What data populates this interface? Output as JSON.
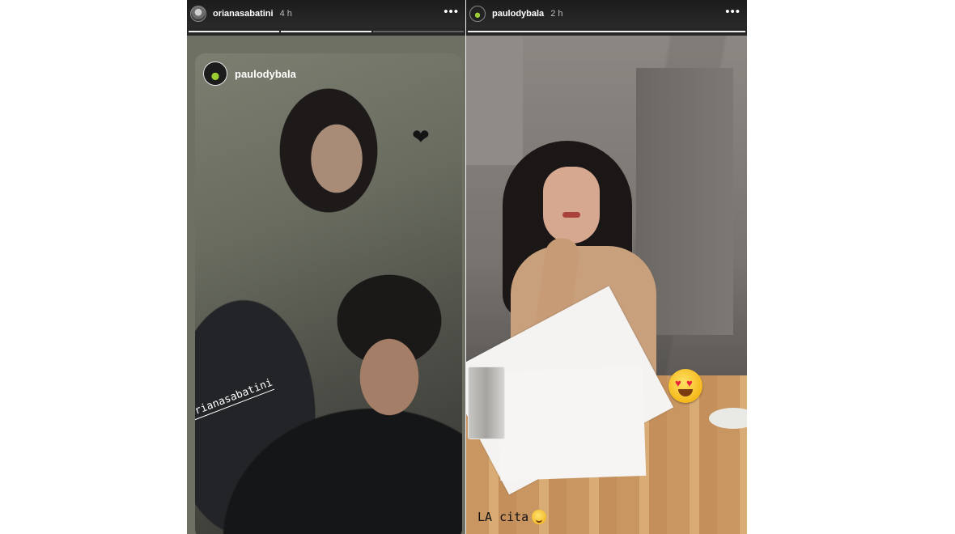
{
  "stories": [
    {
      "username": "orianasabatini",
      "time": "4 h",
      "more_icon": "ellipsis-icon",
      "progress_segments": [
        true,
        true,
        false
      ],
      "reshare": {
        "username": "paulodybala",
        "sticker": "black-heart-icon",
        "mention": "@orianasabatini"
      }
    },
    {
      "username": "paulodybala",
      "time": "2 h",
      "more_icon": "ellipsis-icon",
      "progress_segments": [
        true
      ],
      "sticker": "heart-eyes-emoji-icon",
      "caption": "LA cita",
      "caption_emoji": "relieved-face-icon"
    }
  ],
  "colors": {
    "header_bg": "#262626",
    "text_white": "#ffffff"
  }
}
